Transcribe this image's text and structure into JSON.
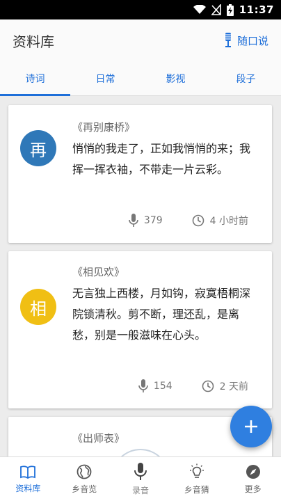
{
  "status": {
    "time": "11:37"
  },
  "app": {
    "title": "资料库",
    "action_label": "随口说"
  },
  "tabs": [
    {
      "label": "诗词",
      "active": true
    },
    {
      "label": "日常",
      "active": false
    },
    {
      "label": "影视",
      "active": false
    },
    {
      "label": "段子",
      "active": false
    }
  ],
  "cards": [
    {
      "avatar_char": "再",
      "avatar_color": "#2f78b8",
      "title": "《再别康桥》",
      "text": "悄悄的我走了，正如我悄悄的来；我挥一挥衣袖，不带走一片云彩。",
      "plays": "379",
      "time": "4 小时前"
    },
    {
      "avatar_char": "相",
      "avatar_color": "#f0bf14",
      "title": "《相见欢》",
      "text": "无言独上西楼，月如钩，寂寞梧桐深院锁清秋。剪不断，理还乱，是离愁，别是一般滋味在心头。",
      "plays": "154",
      "time": "2 天前"
    },
    {
      "title": "《出师表》"
    }
  ],
  "nav": [
    {
      "label": "资料库",
      "icon": "book-icon",
      "active": true
    },
    {
      "label": "乡音览",
      "icon": "globe-icon",
      "active": false
    },
    {
      "label": "录音",
      "icon": "microphone-icon",
      "active": false
    },
    {
      "label": "乡音猜",
      "icon": "lightbulb-icon",
      "active": false
    },
    {
      "label": "更多",
      "icon": "compass-icon",
      "active": false
    }
  ],
  "colors": {
    "accent": "#1e6fd9",
    "fab": "#2f7fe0"
  }
}
